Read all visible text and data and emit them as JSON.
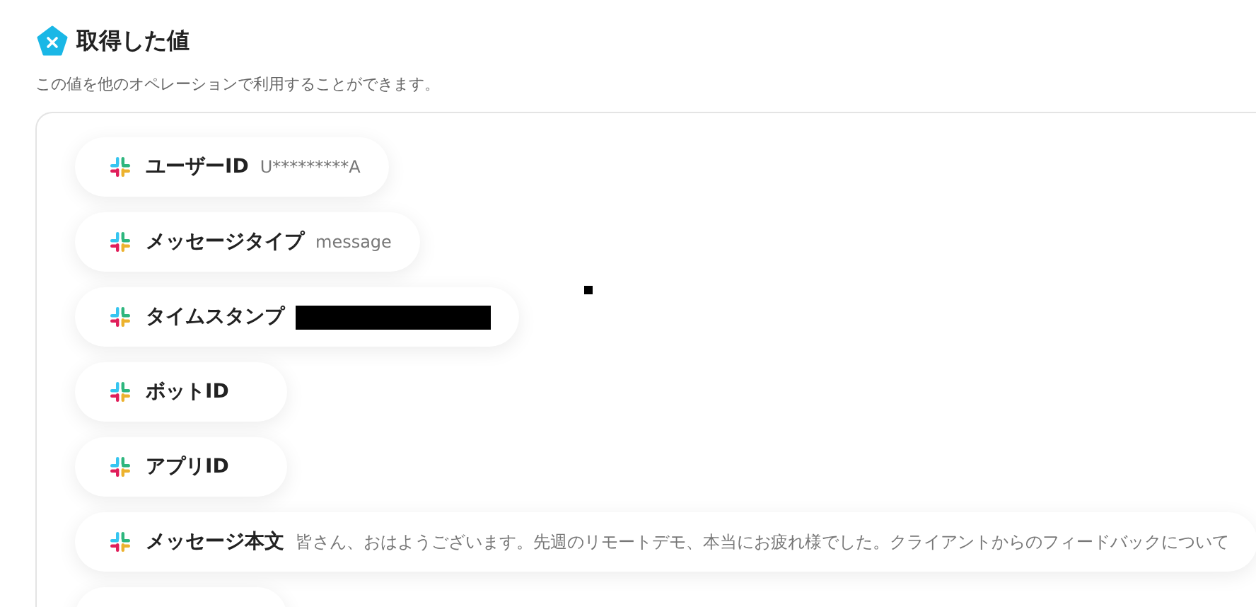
{
  "section": {
    "title": "取得した値",
    "description": "この値を他のオペレーションで利用することができます。"
  },
  "fields": [
    {
      "label": "ユーザーID",
      "value": "U*********A",
      "redacted": false
    },
    {
      "label": "メッセージタイプ",
      "value": "message",
      "redacted": false
    },
    {
      "label": "タイムスタンプ",
      "redacted": true
    },
    {
      "label": "ボットID",
      "redacted": false
    },
    {
      "label": "アプリID",
      "redacted": false
    },
    {
      "label": "メッセージ本文",
      "value": "皆さん、おはようございます。先週のリモートデモ、本当にお疲れ様でした。クライアントからのフィードバックについて",
      "redacted": false
    },
    {
      "redacted": false
    }
  ]
}
